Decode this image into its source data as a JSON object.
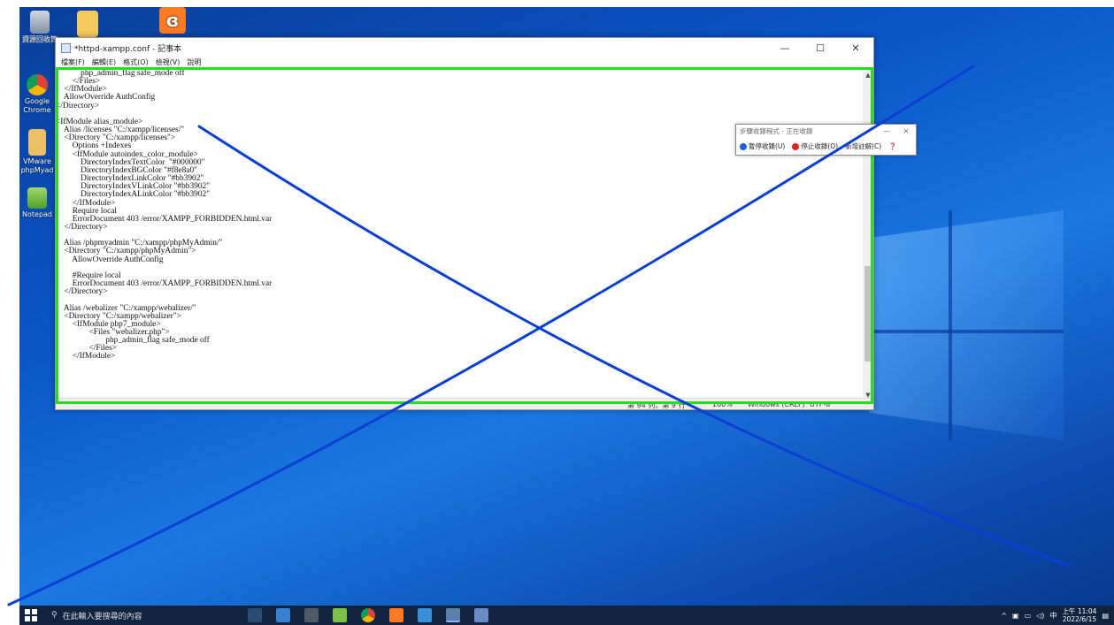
{
  "desktop": {
    "icons": [
      {
        "label": "資源回收筒",
        "icon": "recycle-bin-icon"
      },
      {
        "label": "",
        "icon": "folder-icon"
      },
      {
        "label": "",
        "icon": "xampp-icon"
      },
      {
        "label": "Google Chrome",
        "icon": "chrome-icon"
      },
      {
        "label": "VMware phpMyad",
        "icon": "zip-folder-icon"
      },
      {
        "label": "Notepad",
        "icon": "notepad-plus-icon"
      }
    ]
  },
  "notepad": {
    "title": "*httpd-xampp.conf - 記事本",
    "menu": [
      "檔案(F)",
      "編輯(E)",
      "格式(O)",
      "檢視(V)",
      "說明"
    ],
    "content": "            php_admin_flag safe_mode off\n        </Files>\n    </IfModule>\n    AllowOverride AuthConfig\n</Directory>\n\n<IfModule alias_module>\n    Alias /licenses \"C:/xampp/licenses/\"\n    <Directory \"C:/xampp/licenses\">\n        Options +Indexes\n        <IfModule autoindex_color_module>\n            DirectoryIndexTextColor  \"#000000\"\n            DirectoryIndexBGColor \"#f8e8a0\"\n            DirectoryIndexLinkColor \"#bb3902\"\n            DirectoryIndexVLinkColor \"#bb3902\"\n            DirectoryIndexALinkColor \"#bb3902\"\n        </IfModule>\n        Require local\n        ErrorDocument 403 /error/XAMPP_FORBIDDEN.html.var\n    </Directory>\n\n    Alias /phpmyadmin \"C:/xampp/phpMyAdmin/\"\n    <Directory \"C:/xampp/phpMyAdmin\">\n        AllowOverride AuthConfig\n\n        #Require local\n        ErrorDocument 403 /error/XAMPP_FORBIDDEN.html.var\n    </Directory>\n\n    Alias /webalizer \"C:/xampp/webalizer/\"\n    <Directory \"C:/xampp/webalizer\">\n        <IfModule php7_module>\n                <Files \"webalizer.php\">\n                        php_admin_flag safe_mode off\n                </Files>\n        </IfModule>",
    "status": {
      "position": "第 94 列，第 9 行",
      "zoom": "100%",
      "line_ending": "Windows (CRLF)",
      "encoding": "UTF-8"
    }
  },
  "recorder": {
    "title": "步驟收錄程式 - 正在收錄",
    "pause": "暫停收錄(U)",
    "stop": "停止收錄(O)",
    "comment": "新增註解(C)"
  },
  "taskbar": {
    "search_placeholder": "在此輸入要搜尋的內容",
    "time": "上午 11:04",
    "date": "2022/6/15",
    "ime": "中"
  }
}
